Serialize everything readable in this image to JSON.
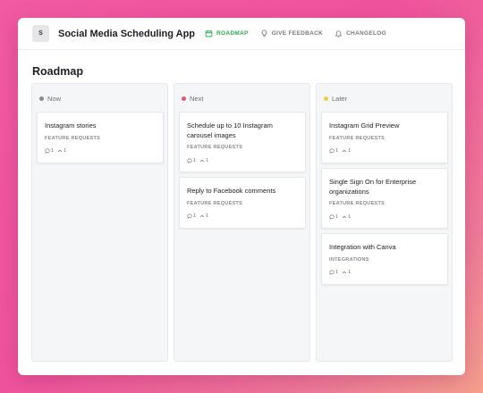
{
  "app": {
    "logo_letter": "S",
    "name": "Social Media Scheduling App"
  },
  "nav": {
    "items": [
      {
        "label": "ROADMAP",
        "icon": "calendar-icon",
        "active": true
      },
      {
        "label": "GIVE FEEDBACK",
        "icon": "lightbulb-icon",
        "active": false
      },
      {
        "label": "CHANGELOG",
        "icon": "bell-icon",
        "active": false
      }
    ]
  },
  "page": {
    "title": "Roadmap"
  },
  "colors": {
    "accent": "#2fa84f",
    "now_dot": "#8a8a92",
    "next_dot": "#e05a78",
    "later_dot": "#f2cc3a"
  },
  "columns": [
    {
      "label": "Now",
      "cards": [
        {
          "title": "Instagram stories",
          "tag": "FEATURE REQUESTS",
          "comments": "1",
          "votes": "1"
        }
      ]
    },
    {
      "label": "Next",
      "cards": [
        {
          "title": "Schedule up to 10 Instagram carousel images",
          "tag": "FEATURE REQUESTS",
          "comments": "1",
          "votes": "1"
        },
        {
          "title": "Reply to Facebook comments",
          "tag": "FEATURE REQUESTS",
          "comments": "1",
          "votes": "1"
        }
      ]
    },
    {
      "label": "Later",
      "cards": [
        {
          "title": "Instagram Grid Preview",
          "tag": "FEATURE REQUESTS",
          "comments": "1",
          "votes": "1"
        },
        {
          "title": "Single Sign On for Enterprise organizations",
          "tag": "FEATURE REQUESTS",
          "comments": "1",
          "votes": "1"
        },
        {
          "title": "Integration with Canva",
          "tag": "INTEGRATIONS",
          "comments": "1",
          "votes": "1"
        }
      ]
    }
  ]
}
